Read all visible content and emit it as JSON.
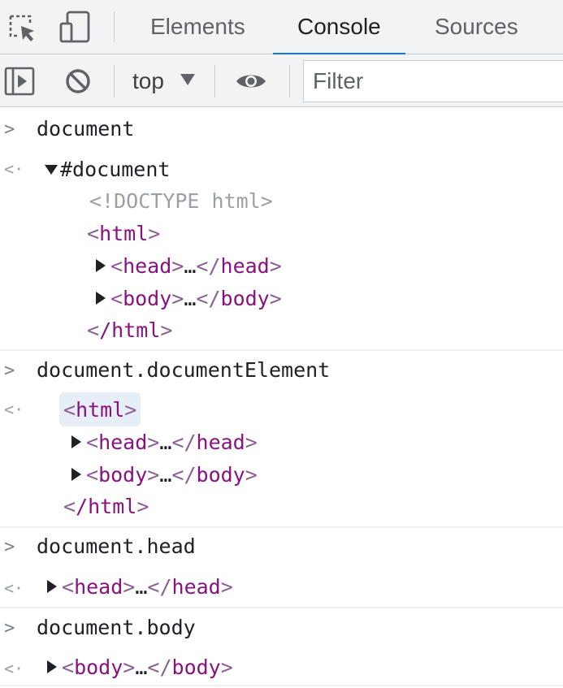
{
  "tabs": {
    "elements": "Elements",
    "console": "Console",
    "sources": "Sources"
  },
  "toolbar": {
    "context": "top",
    "filter_placeholder": "Filter"
  },
  "console": {
    "entry1": {
      "input": "document",
      "root": "#document",
      "doctype": "<!DOCTYPE html>",
      "html_open_name": "html",
      "head_name": "head",
      "body_name": "body",
      "ellipsis": "…",
      "html_close_name": "/html"
    },
    "entry2": {
      "input": "document.documentElement",
      "html_open_name": "html",
      "head_name": "head",
      "body_name": "body",
      "ellipsis": "…",
      "html_close_name": "/html"
    },
    "entry3": {
      "input": "document.head",
      "head_name": "head",
      "ellipsis": "…"
    },
    "entry4": {
      "input": "document.body",
      "body_name": "body",
      "ellipsis": "…"
    }
  },
  "colors": {
    "accent": "#1a73e8",
    "tag": "#881280",
    "bracket": "#8a5e93",
    "doctype": "#9aa0a6"
  }
}
